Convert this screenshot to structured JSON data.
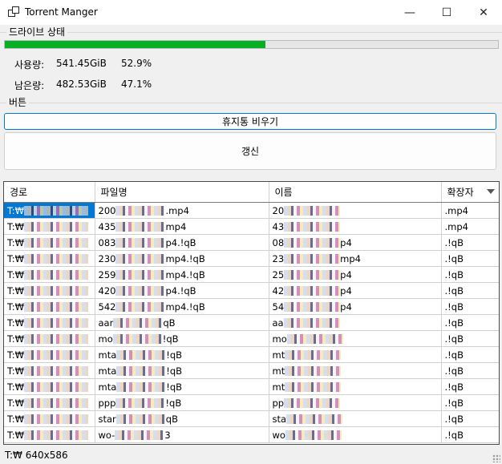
{
  "window": {
    "title": "Torrent Manger",
    "minimize": "—",
    "maximize": "☐",
    "close": "✕"
  },
  "drive": {
    "group_label": "드라이브 상태",
    "used_fraction": 0.529,
    "used_label": "사용량:",
    "used_value": "541.45GiB",
    "used_percent": "52.9%",
    "free_label": "남은량:",
    "free_value": "482.53GiB",
    "free_percent": "47.1%"
  },
  "buttons": {
    "group_label": "버튼",
    "empty_trash": "휴지통 비우기",
    "refresh": "갱신"
  },
  "grid": {
    "columns": [
      "경로",
      "파일명",
      "이름",
      "확장자"
    ],
    "rows": [
      [
        "T:₩",
        "200",
        ".mp4",
        "20",
        "",
        ".mp4"
      ],
      [
        "T:₩",
        "435",
        "mp4",
        "43",
        "",
        ".mp4"
      ],
      [
        "T:₩",
        "083",
        "p4.!qB",
        "08",
        "p4",
        ".!qB"
      ],
      [
        "T:₩",
        "230",
        "mp4.!qB",
        "23",
        "mp4",
        ".!qB"
      ],
      [
        "T:₩",
        "259",
        "mp4.!qB",
        "25",
        "p4",
        ".!qB"
      ],
      [
        "T:₩",
        "420",
        "p4.!qB",
        "42",
        "p4",
        ".!qB"
      ],
      [
        "T:₩",
        "542",
        "mp4.!qB",
        "54",
        "p4",
        ".!qB"
      ],
      [
        "T:₩",
        "aar",
        "qB",
        "aa",
        "",
        ".!qB"
      ],
      [
        "T:₩",
        "mo",
        "!qB",
        "mo",
        "",
        ".!qB"
      ],
      [
        "T:₩",
        "mta",
        "!qB",
        "mt",
        "",
        ".!qB"
      ],
      [
        "T:₩",
        "mta",
        "!qB",
        "mt",
        "",
        ".!qB"
      ],
      [
        "T:₩",
        "mta",
        "!qB",
        "mt",
        "",
        ".!qB"
      ],
      [
        "T:₩",
        "ppp",
        "!qB",
        "pp",
        "",
        ".!qB"
      ],
      [
        "T:₩",
        "star",
        "qB",
        "sta",
        "",
        ".!qB"
      ],
      [
        "T:₩",
        "wo-",
        "3",
        "wo",
        "",
        ".!qB"
      ]
    ]
  },
  "status": {
    "text": "T:₩  640x586"
  }
}
